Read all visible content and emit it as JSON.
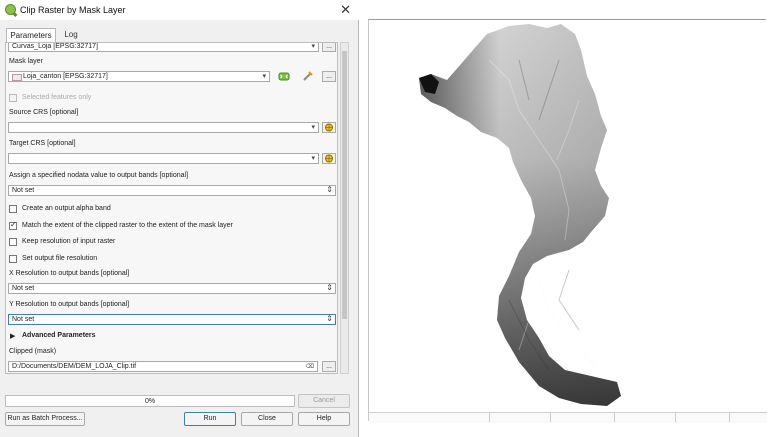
{
  "window": {
    "title": "Clip Raster by Mask Layer",
    "close_glyph": "✕"
  },
  "tabs": [
    "Parameters",
    "Log"
  ],
  "params": {
    "input_layer_value": "Curvas_Loja [EPSG:32717]",
    "mask_label": "Mask layer",
    "mask_value": "Loja_canton [EPSG:32717]",
    "selected_only_label": "Selected features only",
    "source_crs_label": "Source CRS [optional]",
    "target_crs_label": "Target CRS [optional]",
    "nodata_label": "Assign a specified nodata value to output bands [optional]",
    "nodata_value": "Not set",
    "alpha_label": "Create an output alpha band",
    "match_extent_label": "Match the extent of the clipped raster to the extent of the mask layer",
    "keep_res_label": "Keep resolution of input raster",
    "set_res_label": "Set output file resolution",
    "xres_label": "X Resolution to output bands [optional]",
    "xres_value": "Not set",
    "yres_label": "Y Resolution to output bands [optional]",
    "yres_value": "Not set",
    "advanced_label": "Advanced Parameters",
    "clipped_label": "Clipped (mask)",
    "clipped_value": "D:/Documents/DEM/DEM_LOJA_Clip.tif",
    "more_glyph": "...",
    "checks": {
      "selected_only": false,
      "alpha": false,
      "match_extent": true,
      "keep_res": false,
      "set_res": false
    }
  },
  "footer": {
    "progress_text": "0%",
    "progress": 0,
    "cancel": "Cancel",
    "batch": "Run as Batch Process...",
    "run": "Run",
    "close": "Close",
    "help": "Help"
  },
  "colors": {
    "accent": "#3c7fb1",
    "qgis_green": "#8bc34a"
  }
}
